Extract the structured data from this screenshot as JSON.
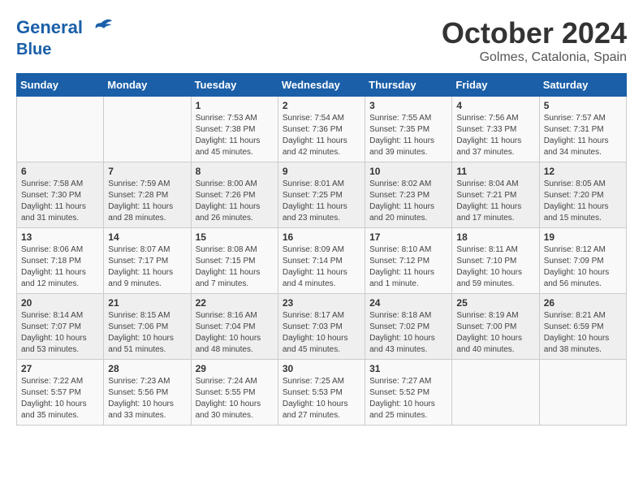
{
  "header": {
    "logo_line1": "General",
    "logo_line2": "Blue",
    "month": "October 2024",
    "location": "Golmes, Catalonia, Spain"
  },
  "weekdays": [
    "Sunday",
    "Monday",
    "Tuesday",
    "Wednesday",
    "Thursday",
    "Friday",
    "Saturday"
  ],
  "weeks": [
    [
      {
        "day": "",
        "info": ""
      },
      {
        "day": "",
        "info": ""
      },
      {
        "day": "1",
        "info": "Sunrise: 7:53 AM\nSunset: 7:38 PM\nDaylight: 11 hours and 45 minutes."
      },
      {
        "day": "2",
        "info": "Sunrise: 7:54 AM\nSunset: 7:36 PM\nDaylight: 11 hours and 42 minutes."
      },
      {
        "day": "3",
        "info": "Sunrise: 7:55 AM\nSunset: 7:35 PM\nDaylight: 11 hours and 39 minutes."
      },
      {
        "day": "4",
        "info": "Sunrise: 7:56 AM\nSunset: 7:33 PM\nDaylight: 11 hours and 37 minutes."
      },
      {
        "day": "5",
        "info": "Sunrise: 7:57 AM\nSunset: 7:31 PM\nDaylight: 11 hours and 34 minutes."
      }
    ],
    [
      {
        "day": "6",
        "info": "Sunrise: 7:58 AM\nSunset: 7:30 PM\nDaylight: 11 hours and 31 minutes."
      },
      {
        "day": "7",
        "info": "Sunrise: 7:59 AM\nSunset: 7:28 PM\nDaylight: 11 hours and 28 minutes."
      },
      {
        "day": "8",
        "info": "Sunrise: 8:00 AM\nSunset: 7:26 PM\nDaylight: 11 hours and 26 minutes."
      },
      {
        "day": "9",
        "info": "Sunrise: 8:01 AM\nSunset: 7:25 PM\nDaylight: 11 hours and 23 minutes."
      },
      {
        "day": "10",
        "info": "Sunrise: 8:02 AM\nSunset: 7:23 PM\nDaylight: 11 hours and 20 minutes."
      },
      {
        "day": "11",
        "info": "Sunrise: 8:04 AM\nSunset: 7:21 PM\nDaylight: 11 hours and 17 minutes."
      },
      {
        "day": "12",
        "info": "Sunrise: 8:05 AM\nSunset: 7:20 PM\nDaylight: 11 hours and 15 minutes."
      }
    ],
    [
      {
        "day": "13",
        "info": "Sunrise: 8:06 AM\nSunset: 7:18 PM\nDaylight: 11 hours and 12 minutes."
      },
      {
        "day": "14",
        "info": "Sunrise: 8:07 AM\nSunset: 7:17 PM\nDaylight: 11 hours and 9 minutes."
      },
      {
        "day": "15",
        "info": "Sunrise: 8:08 AM\nSunset: 7:15 PM\nDaylight: 11 hours and 7 minutes."
      },
      {
        "day": "16",
        "info": "Sunrise: 8:09 AM\nSunset: 7:14 PM\nDaylight: 11 hours and 4 minutes."
      },
      {
        "day": "17",
        "info": "Sunrise: 8:10 AM\nSunset: 7:12 PM\nDaylight: 11 hours and 1 minute."
      },
      {
        "day": "18",
        "info": "Sunrise: 8:11 AM\nSunset: 7:10 PM\nDaylight: 10 hours and 59 minutes."
      },
      {
        "day": "19",
        "info": "Sunrise: 8:12 AM\nSunset: 7:09 PM\nDaylight: 10 hours and 56 minutes."
      }
    ],
    [
      {
        "day": "20",
        "info": "Sunrise: 8:14 AM\nSunset: 7:07 PM\nDaylight: 10 hours and 53 minutes."
      },
      {
        "day": "21",
        "info": "Sunrise: 8:15 AM\nSunset: 7:06 PM\nDaylight: 10 hours and 51 minutes."
      },
      {
        "day": "22",
        "info": "Sunrise: 8:16 AM\nSunset: 7:04 PM\nDaylight: 10 hours and 48 minutes."
      },
      {
        "day": "23",
        "info": "Sunrise: 8:17 AM\nSunset: 7:03 PM\nDaylight: 10 hours and 45 minutes."
      },
      {
        "day": "24",
        "info": "Sunrise: 8:18 AM\nSunset: 7:02 PM\nDaylight: 10 hours and 43 minutes."
      },
      {
        "day": "25",
        "info": "Sunrise: 8:19 AM\nSunset: 7:00 PM\nDaylight: 10 hours and 40 minutes."
      },
      {
        "day": "26",
        "info": "Sunrise: 8:21 AM\nSunset: 6:59 PM\nDaylight: 10 hours and 38 minutes."
      }
    ],
    [
      {
        "day": "27",
        "info": "Sunrise: 7:22 AM\nSunset: 5:57 PM\nDaylight: 10 hours and 35 minutes."
      },
      {
        "day": "28",
        "info": "Sunrise: 7:23 AM\nSunset: 5:56 PM\nDaylight: 10 hours and 33 minutes."
      },
      {
        "day": "29",
        "info": "Sunrise: 7:24 AM\nSunset: 5:55 PM\nDaylight: 10 hours and 30 minutes."
      },
      {
        "day": "30",
        "info": "Sunrise: 7:25 AM\nSunset: 5:53 PM\nDaylight: 10 hours and 27 minutes."
      },
      {
        "day": "31",
        "info": "Sunrise: 7:27 AM\nSunset: 5:52 PM\nDaylight: 10 hours and 25 minutes."
      },
      {
        "day": "",
        "info": ""
      },
      {
        "day": "",
        "info": ""
      }
    ]
  ]
}
